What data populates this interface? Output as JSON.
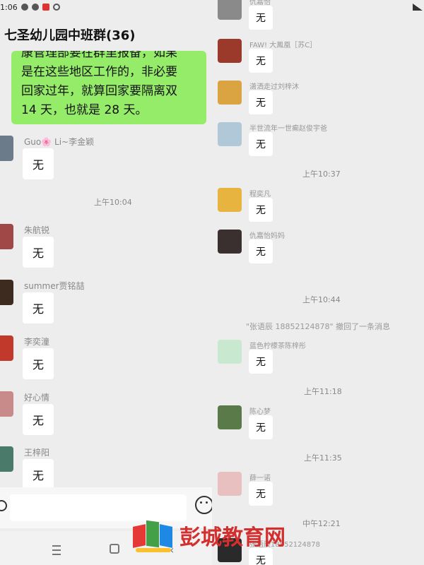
{
  "status_bar": {
    "time": "1:06"
  },
  "left": {
    "chat_title": "七圣幼儿园中班群(36)",
    "highlight_message_lines": [
      "康管理部要在群里报备，如果",
      "是在这些地区工作的，非必要",
      "回家过年，就算回家要隔离双",
      "14 天，也就是 28 天。"
    ],
    "messages": [
      {
        "name": "Guo🌸 Li~李金颖",
        "text": "无",
        "avatar_color": "#6b7b8a"
      },
      {
        "name": "朱航锐",
        "text": "无",
        "avatar_color": "#a04848"
      },
      {
        "name": "summer贾铭喆",
        "text": "无",
        "avatar_color": "#3d2b1f"
      },
      {
        "name": "李奕潼",
        "text": "无",
        "avatar_color": "#c0392b"
      },
      {
        "name": "好心情",
        "text": "无",
        "avatar_color": "#c98a8a"
      },
      {
        "name": "王梓阳",
        "text": "无",
        "avatar_color": "#4a7a6a"
      }
    ],
    "timestamp": "上午10:04"
  },
  "right": {
    "messages": [
      {
        "name": "仇嘉怡",
        "text": "无",
        "avatar_color": "#8a8a8a"
      },
      {
        "name": "FAW! 大鳳凰［苏C］",
        "text": "无",
        "avatar_color": "#9b3a2a"
      },
      {
        "name": "潇洒走过刘梓沐",
        "text": "无",
        "avatar_color": "#d9a441"
      },
      {
        "name": "半世流年一世癫赵俊宇爸",
        "text": "无",
        "avatar_color": "#b0c8d8"
      },
      {
        "name": "程奕凡",
        "text": "无",
        "avatar_color": "#e8b440"
      },
      {
        "name": "仇嘉怡妈妈",
        "text": "无",
        "avatar_color": "#3b3030"
      },
      {
        "name": "蓝色柠檬茶陈梓彤",
        "text": "无",
        "avatar_color": "#c8e8d0"
      },
      {
        "name": "陈心梦",
        "text": "无",
        "avatar_color": "#5a7a4a"
      },
      {
        "name": "薛一诺",
        "text": "无",
        "avatar_color": "#e8c0c0"
      },
      {
        "name": "张语辰18852124878",
        "text": "无",
        "avatar_color": "#2a2a2a"
      }
    ],
    "timestamps": [
      "上午10:37",
      "上午10:44",
      "上午11:18",
      "上午11:35",
      "中午12:21"
    ],
    "recall_notice": "\"张语辰 18852124878\" 撤回了一条消息"
  },
  "watermark": {
    "text": "彭城教育网"
  },
  "colors": {
    "green_bubble": "#95ec69",
    "background": "#ededed"
  },
  "icons": [
    "emoji-icon",
    "menu-nav-icon",
    "home-nav-icon",
    "back-nav-icon",
    "signal-icon"
  ]
}
